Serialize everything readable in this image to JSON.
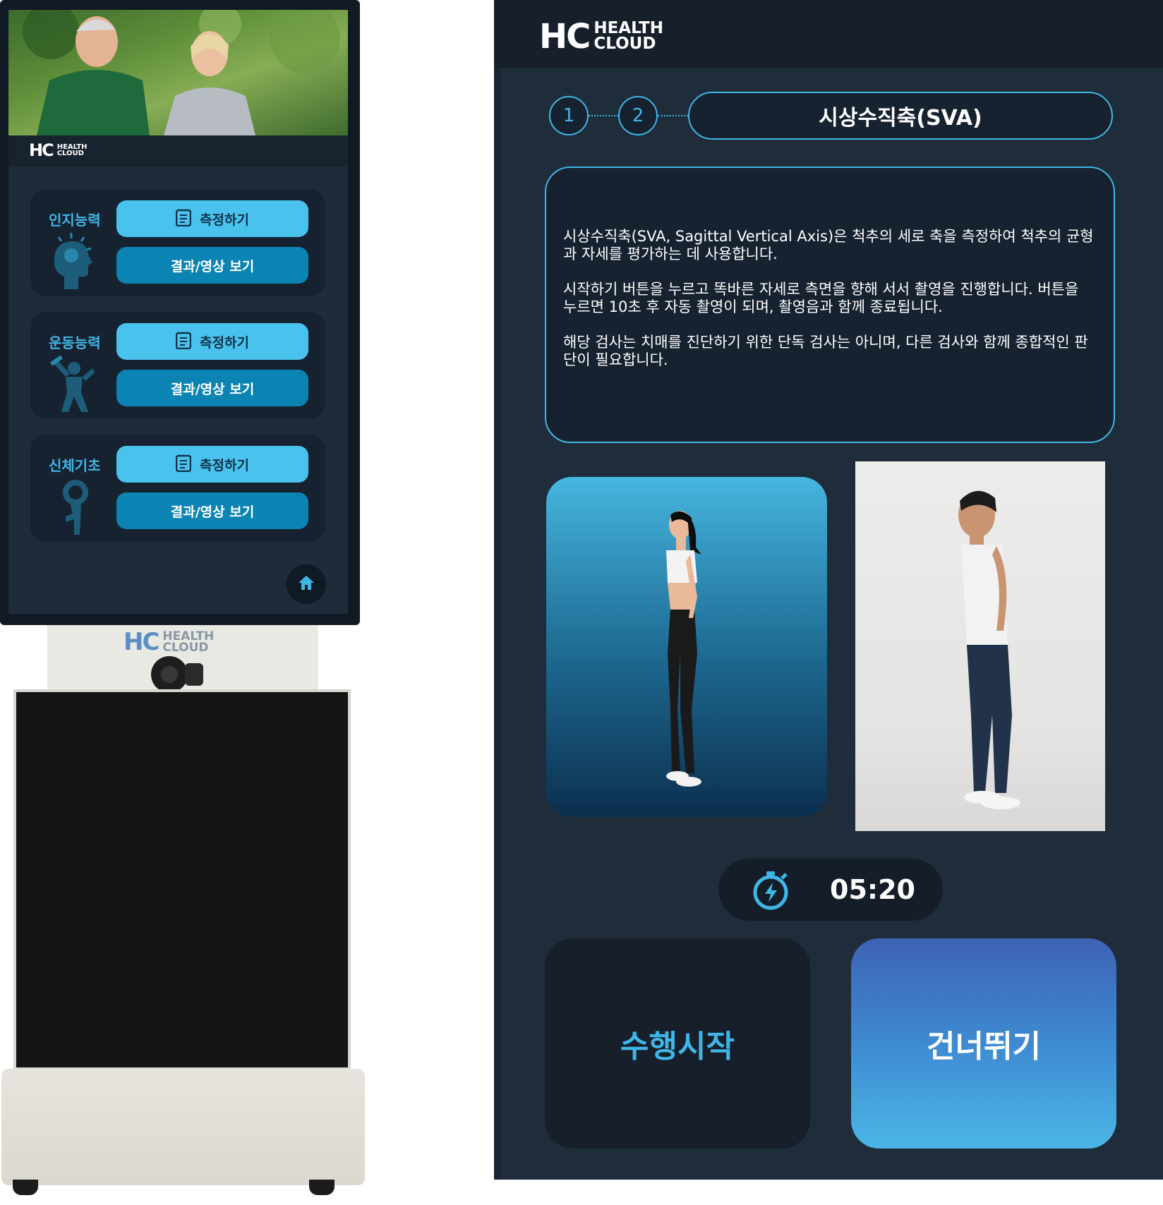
{
  "brand": {
    "mark": "HC",
    "line1": "HEALTH",
    "line2": "CLOUD"
  },
  "kiosk": {
    "categories": [
      {
        "label": "인지능력",
        "icon": "brain-head-icon",
        "measure_label": "측정하기",
        "result_label": "결과/영상 보기"
      },
      {
        "label": "운동능력",
        "icon": "exercise-person-icon",
        "measure_label": "측정하기",
        "result_label": "결과/영상 보기"
      },
      {
        "label": "신체기초",
        "icon": "body-figure-icon",
        "measure_label": "측정하기",
        "result_label": "결과/영상 보기"
      }
    ],
    "home_icon": "home-icon"
  },
  "app": {
    "steps": [
      "1",
      "2"
    ],
    "title": "시상수직축(SVA)",
    "description": [
      "시상수직축(SVA, Sagittal Vertical Axis)은 척추의 세로 축을 측정하여 척추의 균형과 자세를 평가하는 데 사용합니다.",
      "시작하기 버튼을 누르고 똑바른 자세로 측면을 향해 서서 촬영을 진행합니다. 버튼을 누르면 10초 후 자동 촬영이 되며, 촬영음과 함께 종료됩니다.",
      "해당 검사는 치매를 진단하기 위한 단독 검사는 아니며, 다른 검사와 함께 종합적인 판단이 필요합니다."
    ],
    "timer": {
      "icon": "stopwatch-icon",
      "value": "05:20"
    },
    "start_label": "수행시작",
    "skip_label": "건너뛰기"
  },
  "colors": {
    "accent": "#3fb6e6",
    "panel": "#1f2d3b",
    "dark": "#161f2a",
    "measure_btn": "#49c3ee",
    "result_btn": "#0b84b3"
  }
}
